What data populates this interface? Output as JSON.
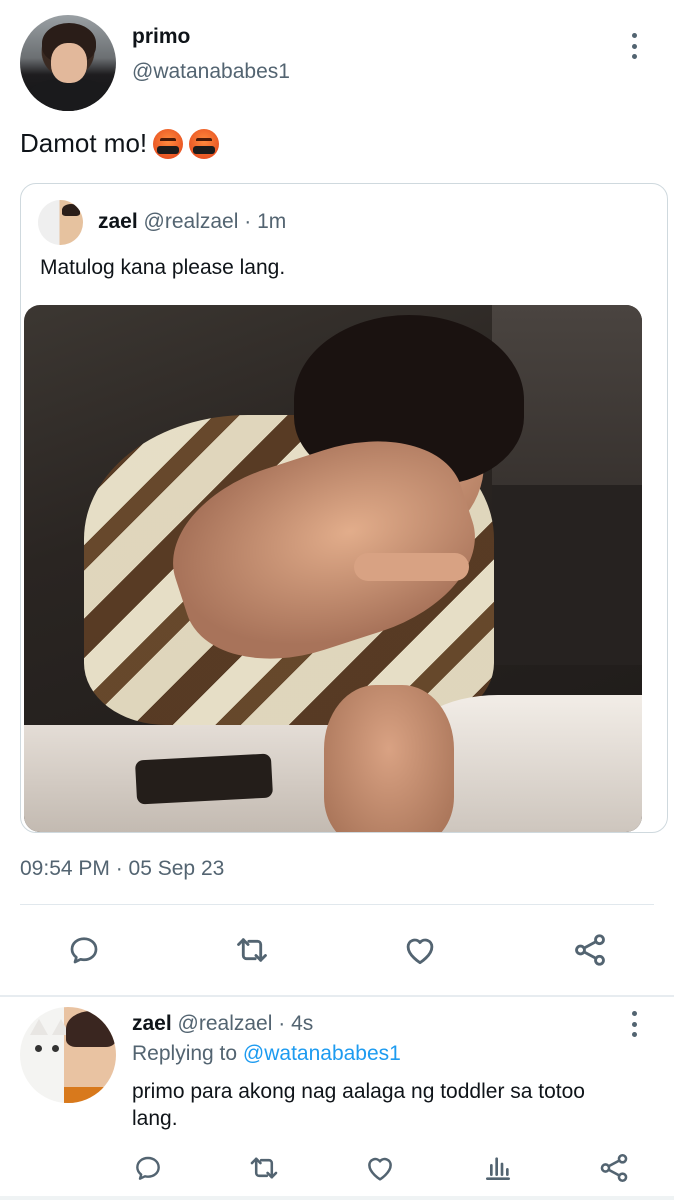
{
  "tweet": {
    "author_name": "primo",
    "author_handle": "@watanababes1",
    "text": "Damot mo!",
    "emojis": [
      "face-with-symbols-on-mouth",
      "face-with-symbols-on-mouth"
    ],
    "timestamp": "09:54 PM · 05 Sep 23"
  },
  "quoted": {
    "author_name": "zael",
    "author_handle": "@realzael",
    "time": "· 1m",
    "text": "Matulog kana please lang."
  },
  "reply": {
    "author_name": "zael",
    "author_handle": "@realzael",
    "time": "· 4s",
    "replying_prefix": "Replying to",
    "replying_to": "@watanababes1",
    "text": "primo para akong nag aalaga ng toddler sa totoo lang."
  },
  "icons": {
    "more": "more-vertical-icon",
    "reply": "reply-icon",
    "retweet": "retweet-icon",
    "like": "heart-icon",
    "share": "share-icon",
    "views": "views-icon"
  },
  "colors": {
    "text_primary": "#0f1419",
    "text_secondary": "#536471",
    "link": "#1d9bf0",
    "border": "#cfd9de"
  }
}
